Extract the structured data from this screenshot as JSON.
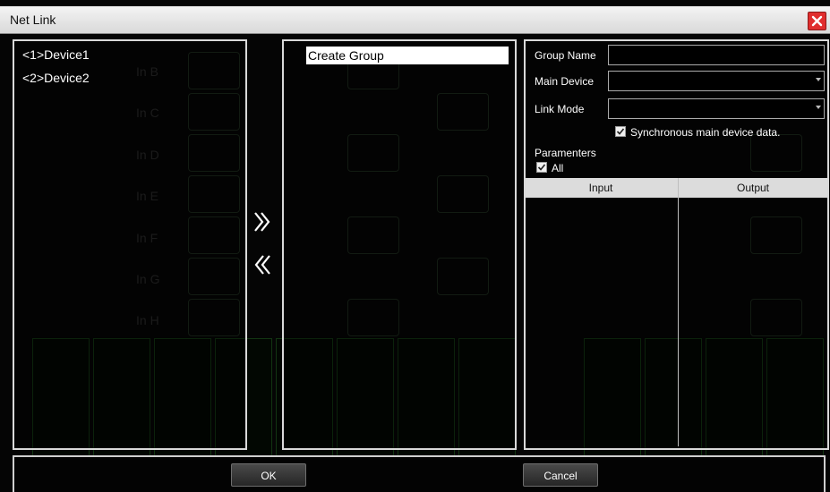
{
  "window": {
    "title": "Net Link",
    "close_icon": "close-icon"
  },
  "devices": [
    {
      "label": "<1>Device1"
    },
    {
      "label": "<2>Device2"
    }
  ],
  "groups": {
    "create_label": "Create Group"
  },
  "transfer": {
    "add_icon": "double-chevron-right-icon",
    "remove_icon": "double-chevron-left-icon"
  },
  "properties": {
    "group_name_label": "Group Name",
    "group_name_value": "",
    "main_device_label": "Main Device",
    "main_device_value": "",
    "link_mode_label": "Link Mode",
    "link_mode_value": "",
    "sync_label": "Synchronous main device data.",
    "sync_checked": true,
    "parameters_label": "Paramenters",
    "all_label": "All",
    "all_checked": true,
    "table_columns": [
      "Input",
      "Output"
    ]
  },
  "buttons": {
    "ok": "OK",
    "cancel": "Cancel"
  },
  "colors": {
    "close": "#e02e2e",
    "border": "#d9d9d9",
    "background": "#000000"
  }
}
